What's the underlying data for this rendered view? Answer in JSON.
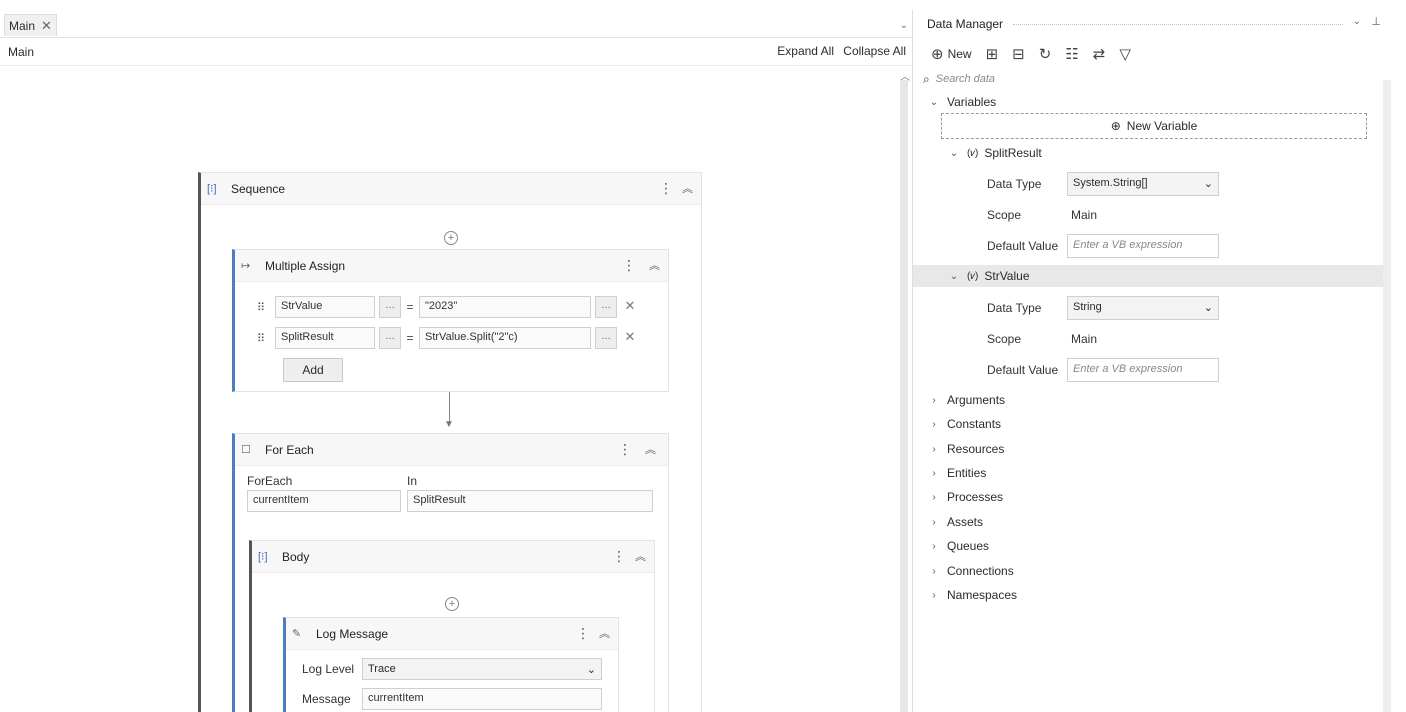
{
  "designer": {
    "tab_label": "Main",
    "breadcrumb": "Main",
    "expand_all": "Expand All",
    "collapse_all": "Collapse All"
  },
  "sequence": {
    "title": "Sequence"
  },
  "multiple_assign": {
    "title": "Multiple Assign",
    "rows": [
      {
        "target": "StrValue",
        "value": "\"2023\""
      },
      {
        "target": "SplitResult",
        "value": "StrValue.Split(\"2\"c)"
      }
    ],
    "add_label": "Add"
  },
  "for_each": {
    "title": "For Each",
    "foreach_label": "ForEach",
    "in_label": "In",
    "item_value": "currentItem",
    "in_value": "SplitResult"
  },
  "body": {
    "title": "Body"
  },
  "log_message": {
    "title": "Log Message",
    "level_label": "Log Level",
    "level_value": "Trace",
    "message_label": "Message",
    "message_value": "currentItem"
  },
  "data_manager": {
    "title": "Data Manager",
    "new_label": "New",
    "search_placeholder": "Search data",
    "variables_label": "Variables",
    "new_variable_label": "New Variable",
    "variables": [
      {
        "name": "SplitResult",
        "data_type_label": "Data Type",
        "data_type": "System.String[]",
        "scope_label": "Scope",
        "scope": "Main",
        "default_label": "Default Value",
        "default_placeholder": "Enter a VB expression"
      },
      {
        "name": "StrValue",
        "data_type_label": "Data Type",
        "data_type": "String",
        "scope_label": "Scope",
        "scope": "Main",
        "default_label": "Default Value",
        "default_placeholder": "Enter a VB expression"
      }
    ],
    "sections": [
      "Arguments",
      "Constants",
      "Resources",
      "Entities",
      "Processes",
      "Assets",
      "Queues",
      "Connections",
      "Namespaces"
    ]
  }
}
